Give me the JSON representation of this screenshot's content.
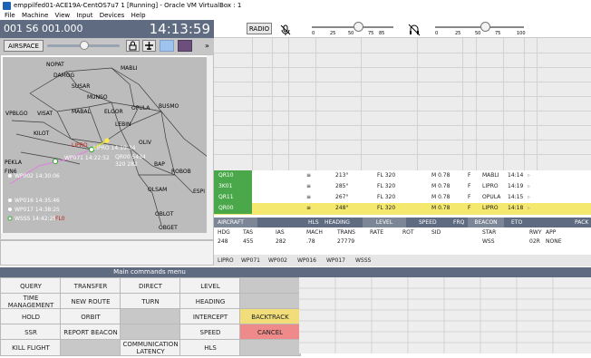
{
  "window": {
    "title": "emppilfed01-ACE19A-CentOS7u7 1 [Running] - Oracle VM VirtualBox : 1"
  },
  "menubar": [
    "File",
    "Machine",
    "View",
    "Input",
    "Devices",
    "Help"
  ],
  "status": {
    "left": "001 S6 001.000",
    "time": "14:13:59"
  },
  "airspace": {
    "label": "AIRSPACE"
  },
  "radar_toolbar": {
    "radio": "RADIO",
    "ticks_a": [
      "0",
      "25",
      "50",
      "75",
      "85"
    ],
    "ticks_b": [
      "0",
      "25",
      "50",
      "75",
      "100"
    ]
  },
  "map": {
    "waypoints": [
      "NOPAT",
      "DAMOG",
      "SUSAR",
      "MABLI",
      "MUNSO",
      "MABAL",
      "ELGOR",
      "OPULA",
      "BUSMO",
      "LEBIN",
      "KILOT",
      "VPBLGO",
      "VISAT",
      "OLIV",
      "PEKLA",
      "FIN6",
      "ROBOB",
      "OLSAM",
      "OBLOT",
      "OBGET",
      "ESPI",
      "BAP"
    ],
    "flight_labels": {
      "lipro": "LIPRO",
      "wp_a": "WP002 14:30:06",
      "wp_b": "WP016 14:35:46",
      "wp_c": "WP017 14:38:25",
      "wp_d": "WSSS 14:42:25",
      "fl": "FL0",
      "qr_tag1": "QR00 5434",
      "qr_tag2": "320 282",
      "lipro_time": "LIPRO 14:19:34",
      "wp071_time": "WP071 14:22:52"
    }
  },
  "main_menu": {
    "title": "Main commands menu",
    "rows": [
      [
        "QUERY",
        "TRANSFER",
        "DIRECT",
        "LEVEL",
        ""
      ],
      [
        "TIME MANAGEMENT",
        "NEW ROUTE",
        "TURN",
        "HEADING",
        ""
      ],
      [
        "HOLD",
        "ORBIT",
        "",
        "INTERCEPT",
        "BACKTRACK"
      ],
      [
        "SSR",
        "REPORT BEACON",
        "",
        "SPEED",
        "CANCEL"
      ],
      [
        "KILL FLIGHT",
        "",
        "COMMUNICATION LATENCY",
        "HLS",
        ""
      ]
    ]
  },
  "flights": [
    {
      "cs": "QR10",
      "icon": "≡",
      "hdg": "213°",
      "lvl": "FL 320",
      "spd": "M 0.78",
      "frq": "F",
      "beacon": "MABLI",
      "eto": "14:14"
    },
    {
      "cs": "3K01",
      "icon": "≡",
      "hdg": "285°",
      "lvl": "FL 320",
      "spd": "M 0.78",
      "frq": "F",
      "beacon": "LIPRO",
      "eto": "14:19"
    },
    {
      "cs": "QR11",
      "icon": "≡",
      "hdg": "267°",
      "lvl": "FL 320",
      "spd": "M 0.78",
      "frq": "F",
      "beacon": "OPULA",
      "eto": "14:15"
    },
    {
      "cs": "QR00",
      "icon": "≡",
      "hdg": "248°",
      "lvl": "FL 320",
      "spd": "M 0.78",
      "frq": "F",
      "beacon": "LIPRO",
      "eto": "14:18"
    }
  ],
  "flight_header": {
    "aircraft": "AIRCRAFT",
    "hls": "HLS",
    "heading": "HEADING",
    "level": "LEVEL",
    "speed": "SPEED",
    "frq": "FRQ",
    "beacon": "BEACON",
    "eto": "ETO",
    "pack": "PACK"
  },
  "detail": {
    "labels": [
      "HDG",
      "TAS",
      "IAS",
      "MACH",
      "TRANS",
      "RATE",
      "ROT",
      "SID",
      "STAR",
      "RWY",
      "APP"
    ],
    "values": [
      "248",
      "455",
      "282",
      ".78",
      "27779",
      "",
      "",
      "",
      "WSS",
      "02R",
      "NONE"
    ]
  },
  "route": [
    "LIPRO",
    "WP071",
    "WP002",
    "WP016",
    "WP017",
    "WSSS"
  ]
}
